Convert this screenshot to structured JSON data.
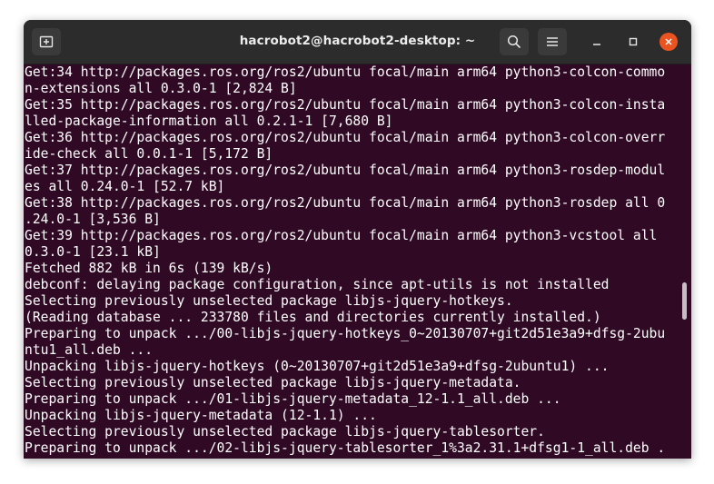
{
  "window": {
    "title": "hacrobot2@hacrobot2-desktop: ~"
  },
  "toolbar": {
    "new_tab_icon": "new-tab-icon",
    "search_icon": "search-icon",
    "menu_icon": "hamburger-menu-icon",
    "minimize_icon": "minimize-icon",
    "maximize_icon": "maximize-icon",
    "close_icon": "close-icon"
  },
  "colors": {
    "terminal_bg": "#300a24",
    "titlebar_bg": "#2c2c2c",
    "close_button": "#e95420",
    "text": "#ffffff"
  },
  "terminal": {
    "lines": [
      "Get:34 http://packages.ros.org/ros2/ubuntu focal/main arm64 python3-colcon-commo",
      "n-extensions all 0.3.0-1 [2,824 B]",
      "Get:35 http://packages.ros.org/ros2/ubuntu focal/main arm64 python3-colcon-insta",
      "lled-package-information all 0.2.1-1 [7,680 B]",
      "Get:36 http://packages.ros.org/ros2/ubuntu focal/main arm64 python3-colcon-overr",
      "ide-check all 0.0.1-1 [5,172 B]",
      "Get:37 http://packages.ros.org/ros2/ubuntu focal/main arm64 python3-rosdep-modul",
      "es all 0.24.0-1 [52.7 kB]",
      "Get:38 http://packages.ros.org/ros2/ubuntu focal/main arm64 python3-rosdep all 0",
      ".24.0-1 [3,536 B]",
      "Get:39 http://packages.ros.org/ros2/ubuntu focal/main arm64 python3-vcstool all",
      "0.3.0-1 [23.1 kB]",
      "Fetched 882 kB in 6s (139 kB/s)",
      "debconf: delaying package configuration, since apt-utils is not installed",
      "Selecting previously unselected package libjs-jquery-hotkeys.",
      "(Reading database ... 233780 files and directories currently installed.)",
      "Preparing to unpack .../00-libjs-jquery-hotkeys_0~20130707+git2d51e3a9+dfsg-2ubu",
      "ntu1_all.deb ...",
      "Unpacking libjs-jquery-hotkeys (0~20130707+git2d51e3a9+dfsg-2ubuntu1) ...",
      "Selecting previously unselected package libjs-jquery-metadata.",
      "Preparing to unpack .../01-libjs-jquery-metadata_12-1.1_all.deb ...",
      "Unpacking libjs-jquery-metadata (12-1.1) ...",
      "Selecting previously unselected package libjs-jquery-tablesorter.",
      "Preparing to unpack .../02-libjs-jquery-tablesorter_1%3a2.31.1+dfsg1-1_all.deb ."
    ]
  }
}
